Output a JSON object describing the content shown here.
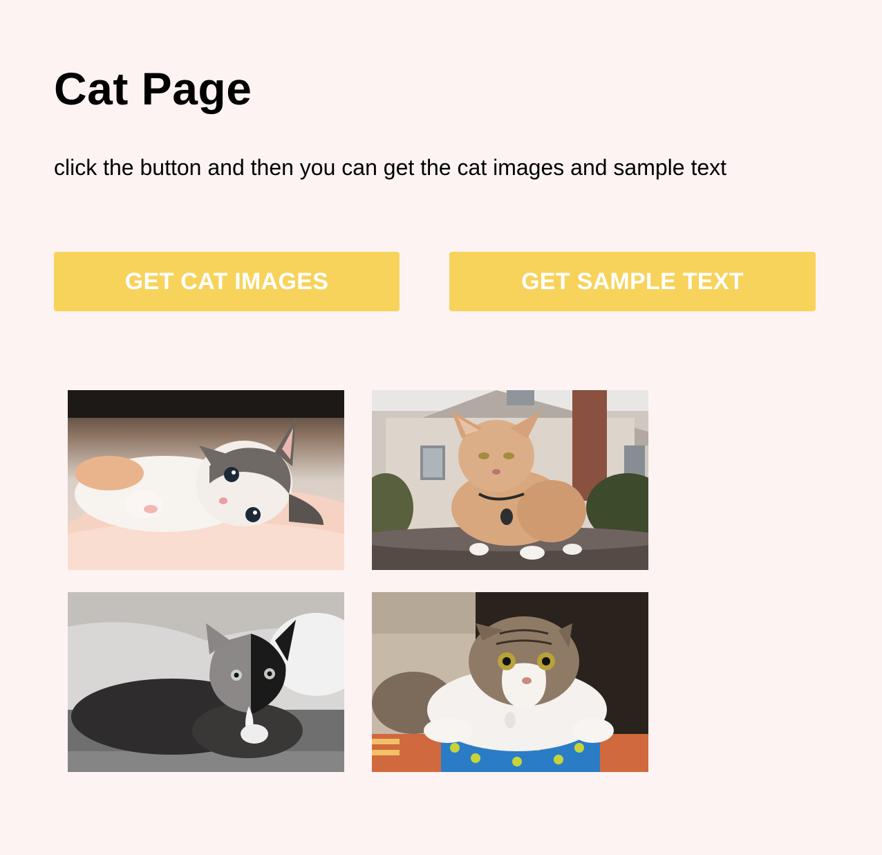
{
  "page": {
    "title": "Cat Page",
    "description": "click the button and then you can get the cat images and sample text"
  },
  "buttons": {
    "get_images_label": "GET CAT IMAGES",
    "get_text_label": "GET SAMPLE TEXT"
  },
  "gallery": {
    "images": [
      {
        "subject": "kitten lying on blanket"
      },
      {
        "subject": "orange cat in front of house"
      },
      {
        "subject": "half black half gray cat lying down"
      },
      {
        "subject": "tabby and white cat sitting in box"
      }
    ]
  },
  "colors": {
    "background": "#fdf3f3",
    "button": "#f7d35c",
    "button_text": "#ffffff"
  }
}
